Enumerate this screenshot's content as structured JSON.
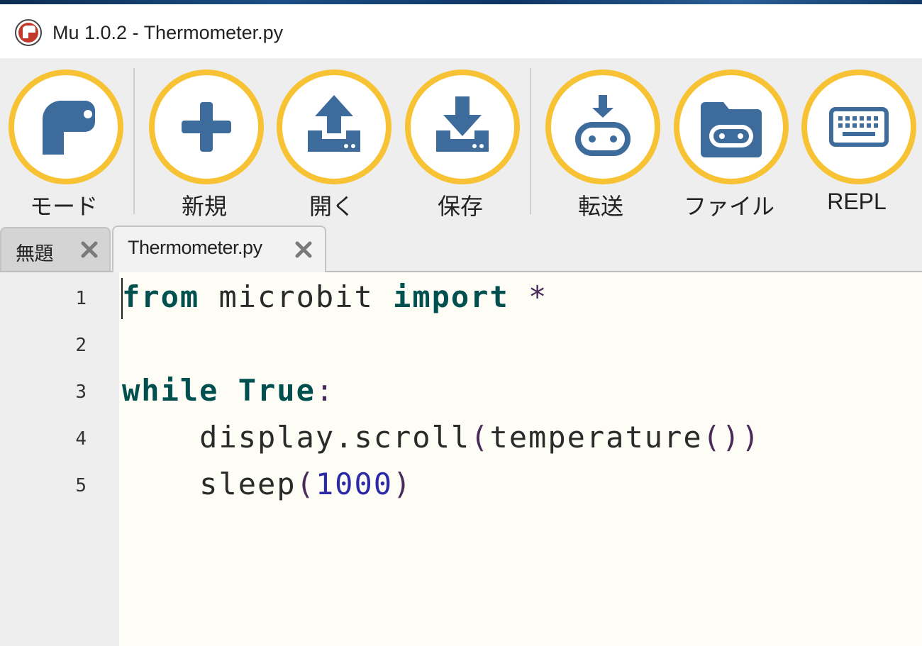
{
  "window": {
    "title": "Mu 1.0.2 - Thermometer.py"
  },
  "toolbar": {
    "mode_label": "モード",
    "new_label": "新規",
    "open_label": "開く",
    "save_label": "保存",
    "flash_label": "転送",
    "files_label": "ファイル",
    "repl_label": "REPL"
  },
  "tabs": [
    {
      "label": "無題",
      "active": false
    },
    {
      "label": "Thermometer.py",
      "active": true
    }
  ],
  "editor": {
    "line_numbers": [
      "1",
      "2",
      "3",
      "4",
      "5"
    ],
    "lines": [
      {
        "kw1": "from",
        "t1": " microbit ",
        "kw2": "import",
        "t2": " *"
      },
      {
        "text": ""
      },
      {
        "kw1": "while",
        "t1": " ",
        "kw2": "True",
        "t2": ":"
      },
      {
        "indent": "    ",
        "t1": "display.scroll",
        "p1": "(",
        "t2": "temperature",
        "p2": "())"
      },
      {
        "indent": "    ",
        "t1": "sleep",
        "p1": "(",
        "num": "1000",
        "p2": ")"
      }
    ]
  },
  "colors": {
    "accent_ring": "#f7c234",
    "icon_blue": "#3d6b9c",
    "keyword": "#005050",
    "number": "#2a2aa8"
  },
  "icons": {
    "mode": "python-mode-icon",
    "new": "plus-icon",
    "open": "upload-tray-icon",
    "save": "download-tray-icon",
    "flash": "microbit-flash-icon",
    "files": "microbit-folder-icon",
    "repl": "keyboard-icon",
    "close": "close-icon"
  }
}
